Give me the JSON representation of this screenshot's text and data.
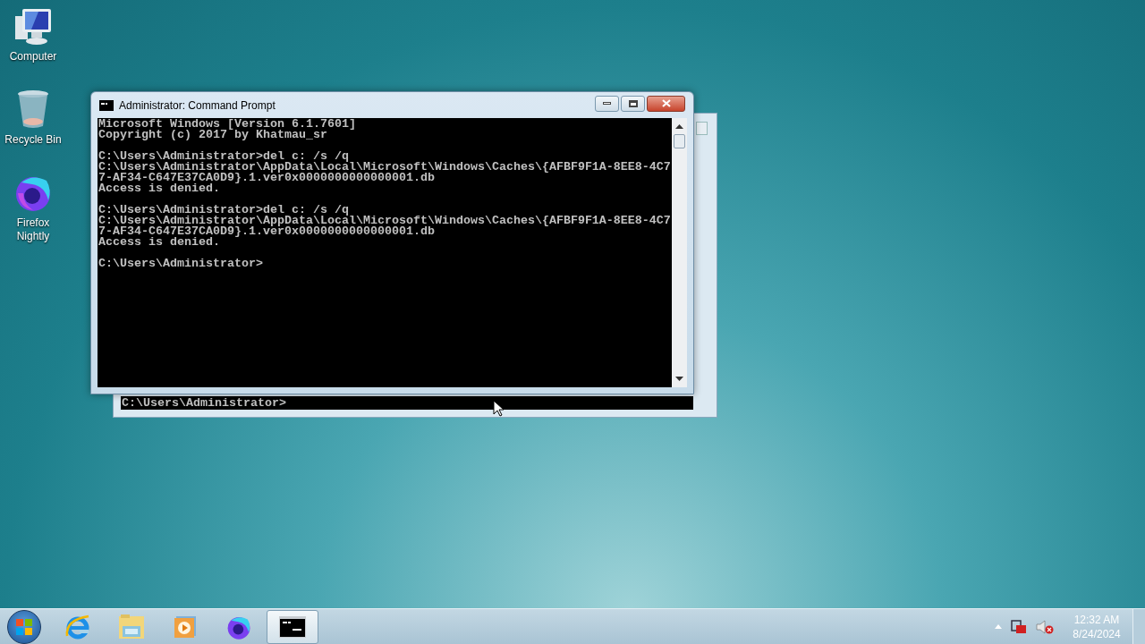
{
  "desktop_icons": [
    {
      "kind": "computer",
      "label": "Computer"
    },
    {
      "kind": "recycle",
      "label": "Recycle Bin"
    },
    {
      "kind": "firefox",
      "label": "Firefox Nightly"
    }
  ],
  "background_window": {
    "console_line": "C:\\Users\\Administrator>"
  },
  "window": {
    "title": "Administrator: Command Prompt",
    "console_blocks": [
      [
        "Microsoft Windows [Version 6.1.7601]",
        "Copyright (c) 2017 by Khatmau_sr"
      ],
      [
        "C:\\Users\\Administrator>del c: /s /q",
        "C:\\Users\\Administrator\\AppData\\Local\\Microsoft\\Windows\\Caches\\{AFBF9F1A-8EE8-4C7",
        "7-AF34-C647E37CA0D9}.1.ver0x0000000000000001.db",
        "Access is denied."
      ],
      [
        "C:\\Users\\Administrator>del c: /s /q",
        "C:\\Users\\Administrator\\AppData\\Local\\Microsoft\\Windows\\Caches\\{AFBF9F1A-8EE8-4C7",
        "7-AF34-C647E37CA0D9}.1.ver0x0000000000000001.db",
        "Access is denied."
      ],
      [
        "C:\\Users\\Administrator>"
      ]
    ]
  },
  "taskbar": {
    "items": [
      {
        "kind": "ie",
        "selected": false
      },
      {
        "kind": "explorer",
        "selected": false
      },
      {
        "kind": "media",
        "selected": false
      },
      {
        "kind": "firefox",
        "selected": false
      },
      {
        "kind": "cmd",
        "selected": true
      }
    ],
    "clock": {
      "time": "12:32 AM",
      "date": "8/24/2024"
    }
  }
}
